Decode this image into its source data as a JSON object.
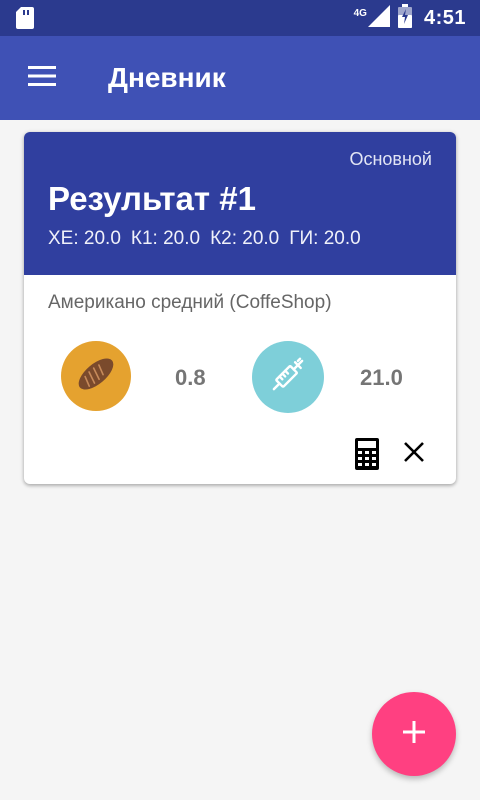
{
  "status_bar": {
    "network": "4G",
    "time": "4:51",
    "icons": [
      "sd-card-icon",
      "signal-icon",
      "battery-icon"
    ]
  },
  "app_bar": {
    "title": "Дневник",
    "menu_icon": "menu-icon"
  },
  "card": {
    "type_label": "Основной",
    "title": "Результат #1",
    "values": [
      {
        "label": "ХЕ: 20.0"
      },
      {
        "label": "К1: 20.0"
      },
      {
        "label": "К2: 20.0"
      },
      {
        "label": "ГИ: 20.0"
      }
    ],
    "product": "Американо средний (CoffeShop)",
    "bread_units": "0.8",
    "insulin": "21.0",
    "icons": [
      "bread-icon",
      "syringe-icon",
      "calculator-icon",
      "close-icon"
    ]
  },
  "fab": {
    "icon": "plus-icon"
  },
  "colors": {
    "status_bar": "#2b3a8e",
    "app_bar": "#3f51b5",
    "card_header": "#303f9f",
    "bread_circle": "#e5a22f",
    "syringe_circle": "#7ecfd9",
    "fab": "#ff4081",
    "background": "#f5f5f5"
  }
}
